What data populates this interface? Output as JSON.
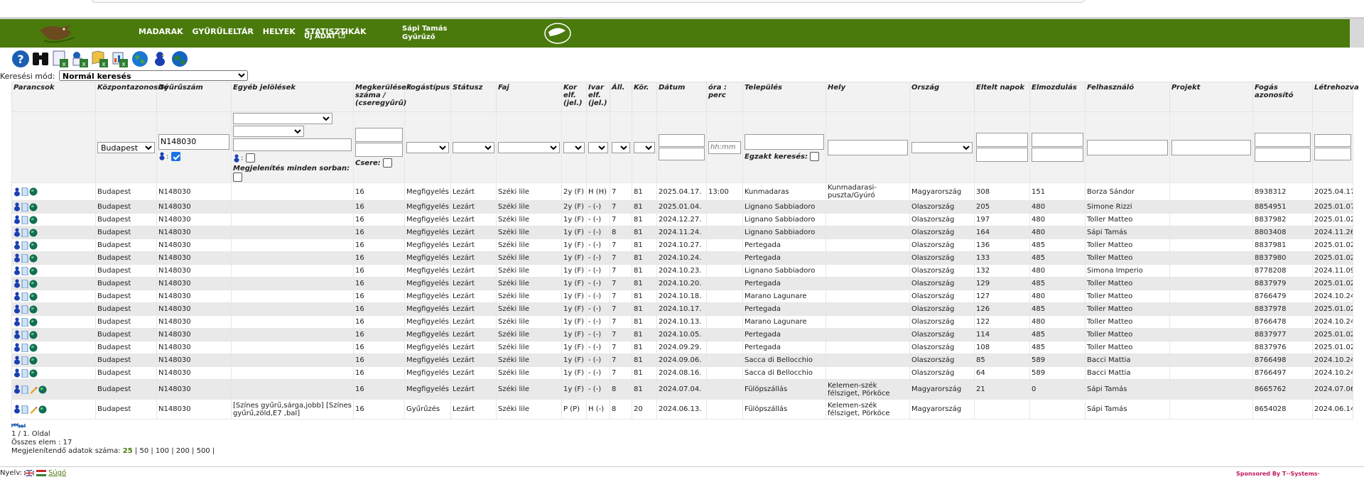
{
  "nav": {
    "items": [
      "MADARAK",
      "GYŰRŰLELTÁR",
      "HELYEK",
      "STATISZTIKÁK"
    ],
    "edit_label": "Új ADAT"
  },
  "user": {
    "name": "Sápi Tamás",
    "role": "Gyűrűző"
  },
  "search_mode": {
    "label": "Keresési mód:",
    "value": "Normál keresés"
  },
  "columns": [
    "Parancsok",
    "Központazonosító",
    "Gyűrűszám",
    "Egyéb jelölések",
    "Megkerülések száma / (cseregyűrű)",
    "Fogástípus",
    "Státusz",
    "Faj",
    "Kor elf. (jel.)",
    "Ivar elf. (jel.)",
    "Áll.",
    "Kör.",
    "Dátum",
    "óra : perc",
    "Település",
    "Hely",
    "Ország",
    "Eltelt napok",
    "Elmozdulás",
    "Felhasználó",
    "Projekt",
    "Fogás azonosító",
    "Létrehozva"
  ],
  "filters": {
    "central": "Budapest",
    "ring_number": "N148030",
    "time_placeholder": "hh:mm",
    "swap_label": "Csere:",
    "show_all_label": "Megjelenítés minden sorban:",
    "exact_label": "Egzakt keresés:",
    "ring_icon_label": ":"
  },
  "rows": [
    {
      "central": "Budapest",
      "ring": "N148030",
      "other": "",
      "count": "16",
      "type": "Megfigyelés",
      "status": "Lezárt",
      "species": "Széki lile",
      "age": "2y (F)",
      "sex": "H (H)",
      "all": "7",
      "kor": "81",
      "date": "2025.04.17.",
      "time": "13:00",
      "town": "Kunmadaras",
      "place": "Kunmadarasi-puszta/Gyúró",
      "country": "Magyarország",
      "days": "308",
      "dist": "151",
      "user": "Borza Sándor",
      "project": "",
      "catch_id": "8938312",
      "created": "2025.04.17."
    },
    {
      "central": "Budapest",
      "ring": "N148030",
      "other": "",
      "count": "16",
      "type": "Megfigyelés",
      "status": "Lezárt",
      "species": "Széki lile",
      "age": "2y (F)",
      "sex": "- (-)",
      "all": "7",
      "kor": "81",
      "date": "2025.01.04.",
      "time": "",
      "town": "Lignano Sabbiadoro",
      "place": "",
      "country": "Olaszország",
      "days": "205",
      "dist": "480",
      "user": "Simone Rizzi",
      "project": "",
      "catch_id": "8854951",
      "created": "2025.01.07."
    },
    {
      "central": "Budapest",
      "ring": "N148030",
      "other": "",
      "count": "16",
      "type": "Megfigyelés",
      "status": "Lezárt",
      "species": "Széki lile",
      "age": "1y (F)",
      "sex": "- (-)",
      "all": "7",
      "kor": "81",
      "date": "2024.12.27.",
      "time": "",
      "town": "Lignano Sabbiadoro",
      "place": "",
      "country": "Olaszország",
      "days": "197",
      "dist": "480",
      "user": "Toller Matteo",
      "project": "",
      "catch_id": "8837982",
      "created": "2025.01.02."
    },
    {
      "central": "Budapest",
      "ring": "N148030",
      "other": "",
      "count": "16",
      "type": "Megfigyelés",
      "status": "Lezárt",
      "species": "Széki lile",
      "age": "1y (F)",
      "sex": "- (-)",
      "all": "8",
      "kor": "81",
      "date": "2024.11.24.",
      "time": "",
      "town": "Lignano Sabbiadoro",
      "place": "",
      "country": "Olaszország",
      "days": "164",
      "dist": "480",
      "user": "Sápi Tamás",
      "project": "",
      "catch_id": "8803408",
      "created": "2024.11.26."
    },
    {
      "central": "Budapest",
      "ring": "N148030",
      "other": "",
      "count": "16",
      "type": "Megfigyelés",
      "status": "Lezárt",
      "species": "Széki lile",
      "age": "1y (F)",
      "sex": "- (-)",
      "all": "7",
      "kor": "81",
      "date": "2024.10.27.",
      "time": "",
      "town": "Pertegada",
      "place": "",
      "country": "Olaszország",
      "days": "136",
      "dist": "485",
      "user": "Toller Matteo",
      "project": "",
      "catch_id": "8837981",
      "created": "2025.01.02."
    },
    {
      "central": "Budapest",
      "ring": "N148030",
      "other": "",
      "count": "16",
      "type": "Megfigyelés",
      "status": "Lezárt",
      "species": "Széki lile",
      "age": "1y (F)",
      "sex": "- (-)",
      "all": "7",
      "kor": "81",
      "date": "2024.10.24.",
      "time": "",
      "town": "Pertegada",
      "place": "",
      "country": "Olaszország",
      "days": "133",
      "dist": "485",
      "user": "Toller Matteo",
      "project": "",
      "catch_id": "8837980",
      "created": "2025.01.02."
    },
    {
      "central": "Budapest",
      "ring": "N148030",
      "other": "",
      "count": "16",
      "type": "Megfigyelés",
      "status": "Lezárt",
      "species": "Széki lile",
      "age": "1y (F)",
      "sex": "- (-)",
      "all": "7",
      "kor": "81",
      "date": "2024.10.23.",
      "time": "",
      "town": "Lignano Sabbiadoro",
      "place": "",
      "country": "Olaszország",
      "days": "132",
      "dist": "480",
      "user": "Simona Imperio",
      "project": "",
      "catch_id": "8778208",
      "created": "2024.11.09."
    },
    {
      "central": "Budapest",
      "ring": "N148030",
      "other": "",
      "count": "16",
      "type": "Megfigyelés",
      "status": "Lezárt",
      "species": "Széki lile",
      "age": "1y (F)",
      "sex": "- (-)",
      "all": "7",
      "kor": "81",
      "date": "2024.10.20.",
      "time": "",
      "town": "Pertegada",
      "place": "",
      "country": "Olaszország",
      "days": "129",
      "dist": "485",
      "user": "Toller Matteo",
      "project": "",
      "catch_id": "8837979",
      "created": "2025.01.02."
    },
    {
      "central": "Budapest",
      "ring": "N148030",
      "other": "",
      "count": "16",
      "type": "Megfigyelés",
      "status": "Lezárt",
      "species": "Széki lile",
      "age": "1y (F)",
      "sex": "- (-)",
      "all": "7",
      "kor": "81",
      "date": "2024.10.18.",
      "time": "",
      "town": "Marano Lagunare",
      "place": "",
      "country": "Olaszország",
      "days": "127",
      "dist": "480",
      "user": "Toller Matteo",
      "project": "",
      "catch_id": "8766479",
      "created": "2024.10.24."
    },
    {
      "central": "Budapest",
      "ring": "N148030",
      "other": "",
      "count": "16",
      "type": "Megfigyelés",
      "status": "Lezárt",
      "species": "Széki lile",
      "age": "1y (F)",
      "sex": "- (-)",
      "all": "7",
      "kor": "81",
      "date": "2024.10.17.",
      "time": "",
      "town": "Pertegada",
      "place": "",
      "country": "Olaszország",
      "days": "126",
      "dist": "485",
      "user": "Toller Matteo",
      "project": "",
      "catch_id": "8837978",
      "created": "2025.01.02."
    },
    {
      "central": "Budapest",
      "ring": "N148030",
      "other": "",
      "count": "16",
      "type": "Megfigyelés",
      "status": "Lezárt",
      "species": "Széki lile",
      "age": "1y (F)",
      "sex": "- (-)",
      "all": "7",
      "kor": "81",
      "date": "2024.10.13.",
      "time": "",
      "town": "Marano Lagunare",
      "place": "",
      "country": "Olaszország",
      "days": "122",
      "dist": "480",
      "user": "Toller Matteo",
      "project": "",
      "catch_id": "8766478",
      "created": "2024.10.24."
    },
    {
      "central": "Budapest",
      "ring": "N148030",
      "other": "",
      "count": "16",
      "type": "Megfigyelés",
      "status": "Lezárt",
      "species": "Széki lile",
      "age": "1y (F)",
      "sex": "- (-)",
      "all": "7",
      "kor": "81",
      "date": "2024.10.05.",
      "time": "",
      "town": "Pertegada",
      "place": "",
      "country": "Olaszország",
      "days": "114",
      "dist": "485",
      "user": "Toller Matteo",
      "project": "",
      "catch_id": "8837977",
      "created": "2025.01.02."
    },
    {
      "central": "Budapest",
      "ring": "N148030",
      "other": "",
      "count": "16",
      "type": "Megfigyelés",
      "status": "Lezárt",
      "species": "Széki lile",
      "age": "1y (F)",
      "sex": "- (-)",
      "all": "7",
      "kor": "81",
      "date": "2024.09.29.",
      "time": "",
      "town": "Pertegada",
      "place": "",
      "country": "Olaszország",
      "days": "108",
      "dist": "485",
      "user": "Toller Matteo",
      "project": "",
      "catch_id": "8837976",
      "created": "2025.01.02."
    },
    {
      "central": "Budapest",
      "ring": "N148030",
      "other": "",
      "count": "16",
      "type": "Megfigyelés",
      "status": "Lezárt",
      "species": "Széki lile",
      "age": "1y (F)",
      "sex": "- (-)",
      "all": "7",
      "kor": "81",
      "date": "2024.09.06.",
      "time": "",
      "town": "Sacca di Bellocchio",
      "place": "",
      "country": "Olaszország",
      "days": "85",
      "dist": "589",
      "user": "Bacci Mattia",
      "project": "",
      "catch_id": "8766498",
      "created": "2024.10.24."
    },
    {
      "central": "Budapest",
      "ring": "N148030",
      "other": "",
      "count": "16",
      "type": "Megfigyelés",
      "status": "Lezárt",
      "species": "Széki lile",
      "age": "1y (F)",
      "sex": "- (-)",
      "all": "7",
      "kor": "81",
      "date": "2024.08.16.",
      "time": "",
      "town": "Sacca di Bellocchio",
      "place": "",
      "country": "Olaszország",
      "days": "64",
      "dist": "589",
      "user": "Bacci Mattia",
      "project": "",
      "catch_id": "8766497",
      "created": "2024.10.24."
    },
    {
      "central": "Budapest",
      "ring": "N148030",
      "other": "",
      "count": "16",
      "type": "Megfigyelés",
      "status": "Lezárt",
      "species": "Széki lile",
      "age": "1y (F)",
      "sex": "- (-)",
      "all": "8",
      "kor": "81",
      "date": "2024.07.04.",
      "time": "",
      "town": "Fülöpszállás",
      "place": "Kelemen-szék félsziget, Pörköce",
      "country": "Magyarország",
      "days": "21",
      "dist": "0",
      "user": "Sápi Tamás",
      "project": "",
      "catch_id": "8665762",
      "created": "2024.07.06."
    },
    {
      "central": "Budapest",
      "ring": "N148030",
      "other": "[Színes gyűrű,sárga,jobb] [Színes gyűrű,zöld,E7 ,bal]",
      "count": "16",
      "type": "Gyűrűzés",
      "status": "Lezárt",
      "species": "Széki lile",
      "age": "P (P)",
      "sex": "H (-)",
      "all": "8",
      "kor": "20",
      "date": "2024.06.13.",
      "time": "",
      "town": "Fülöpszállás",
      "place": "Kelemen-szék félsziget, Pörköce",
      "country": "Magyarország",
      "days": "",
      "dist": "",
      "user": "Sápi Tamás",
      "project": "",
      "catch_id": "8654028",
      "created": "2024.06.14."
    }
  ],
  "pagination": {
    "page": "1 / 1. Oldal",
    "total": "Összes elem : 17",
    "size_label": "Megjelenítendő adatok száma:",
    "sizes": [
      "25",
      "50",
      "100",
      "200",
      "500"
    ],
    "current_size": "25"
  },
  "footer": {
    "lang_label": "Nyelv:",
    "help": "Súgó",
    "sponsor": "Sponsored By T··Systems·"
  },
  "colors": {
    "header": "#4a7a0c",
    "accent": "#1a73e8",
    "row_alt": "#e9e9e9"
  }
}
